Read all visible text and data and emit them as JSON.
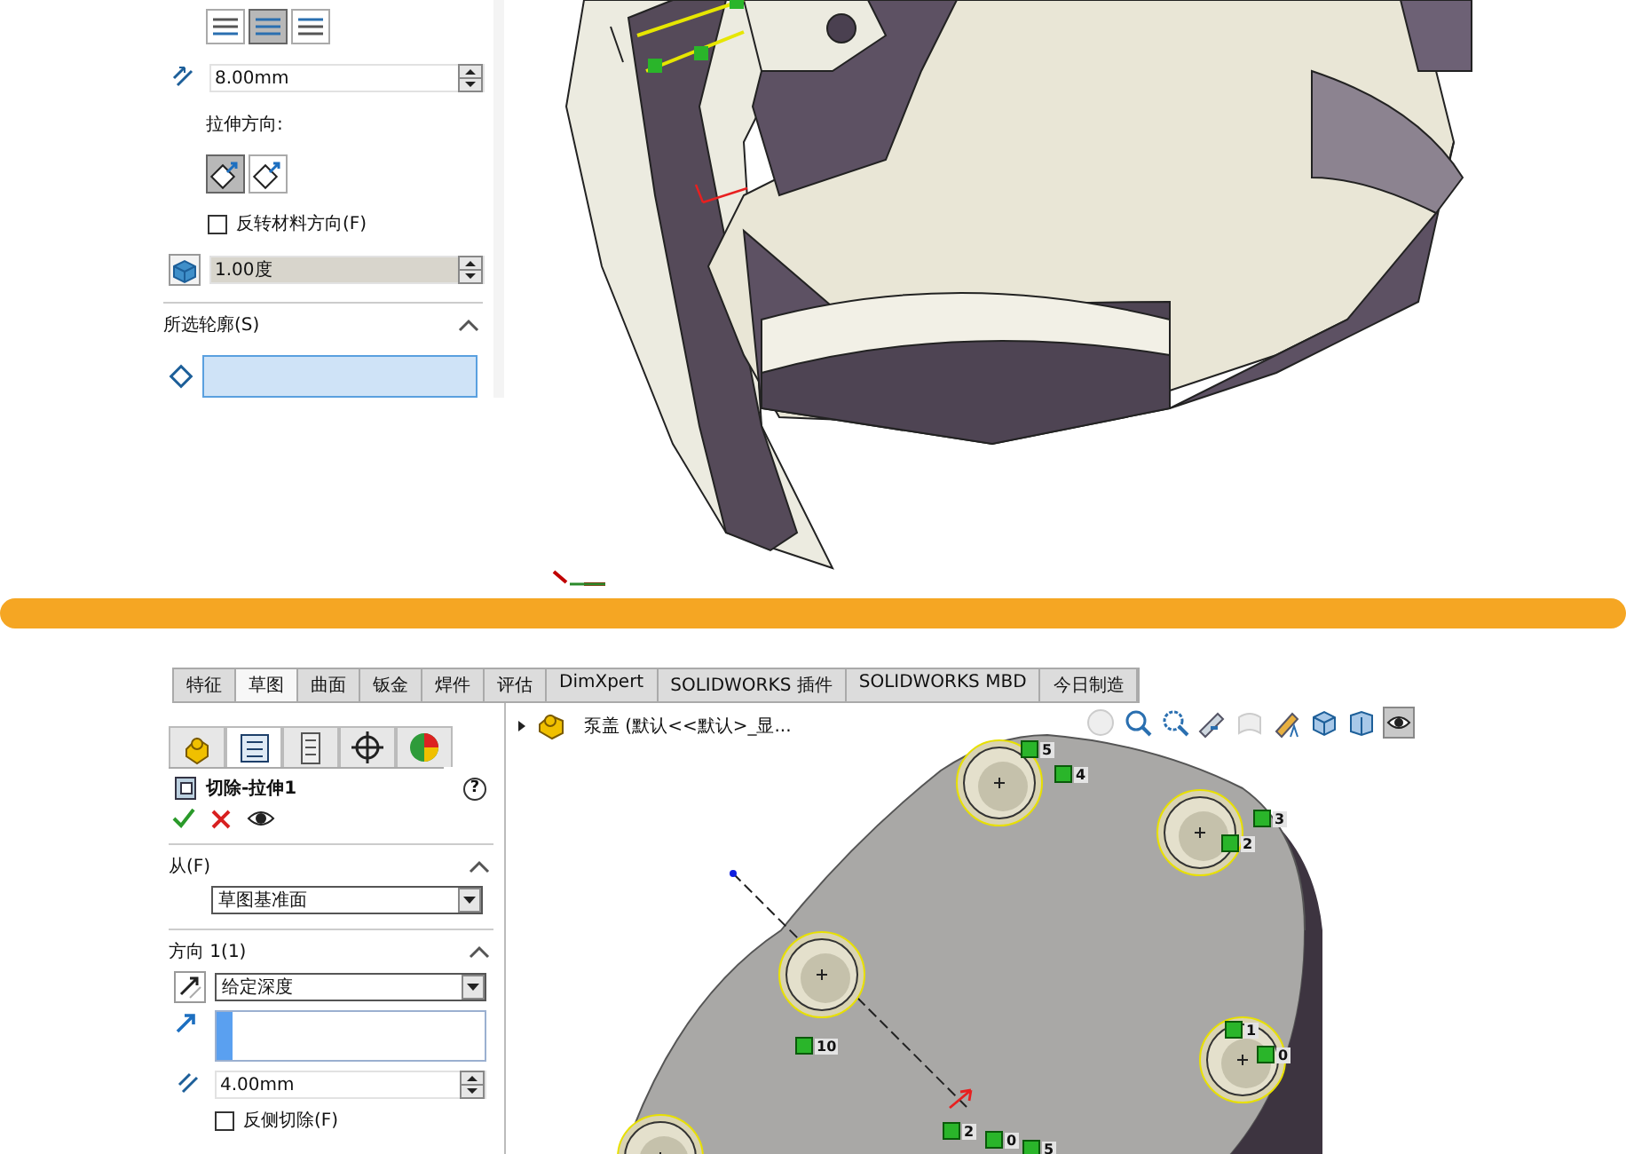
{
  "top_panel": {
    "thickness_buttons": [
      {
        "selected": false
      },
      {
        "selected": true
      },
      {
        "selected": false
      }
    ],
    "thickness_value": "8.00mm",
    "direction_label": "拉伸方向:",
    "direction_buttons": [
      {
        "selected": true
      },
      {
        "selected": false
      }
    ],
    "reverse_checkbox": {
      "label": "反转材料方向(F)",
      "checked": false
    },
    "draft_value": "1.00度",
    "profiles_section": {
      "title": "所选轮廓(S)",
      "expanded": true
    }
  },
  "bottom": {
    "tabs": [
      {
        "label": "特征",
        "selected": false
      },
      {
        "label": "草图",
        "selected": true
      },
      {
        "label": "曲面",
        "selected": false
      },
      {
        "label": "钣金",
        "selected": false
      },
      {
        "label": "焊件",
        "selected": false
      },
      {
        "label": "评估",
        "selected": false
      },
      {
        "label": "DimXpert",
        "selected": false
      },
      {
        "label": "SOLIDWORKS 插件",
        "selected": false
      },
      {
        "label": "SOLIDWORKS MBD",
        "selected": false
      },
      {
        "label": "今日制造",
        "selected": false
      }
    ],
    "tree_path": "泵盖 (默认<<默认>_显...",
    "panel_tabs": [
      {
        "selected": false
      },
      {
        "selected": true
      },
      {
        "selected": false
      },
      {
        "selected": false
      },
      {
        "selected": false
      }
    ],
    "feature_title": "切除-拉伸1",
    "help_glyph": "?",
    "from_section": {
      "title": "从(F)",
      "expanded": true,
      "value": "草图基准面"
    },
    "direction_section": {
      "title": "方向 1(1)",
      "expanded": true,
      "end_condition": "给定深度",
      "depth": "4.00mm",
      "flip_checkbox": {
        "label": "反侧切除(F)",
        "checked": false
      }
    },
    "relation_labels": [
      "5",
      "4",
      "3",
      "2",
      "1",
      "0",
      "10",
      "2",
      "0",
      "5"
    ]
  }
}
